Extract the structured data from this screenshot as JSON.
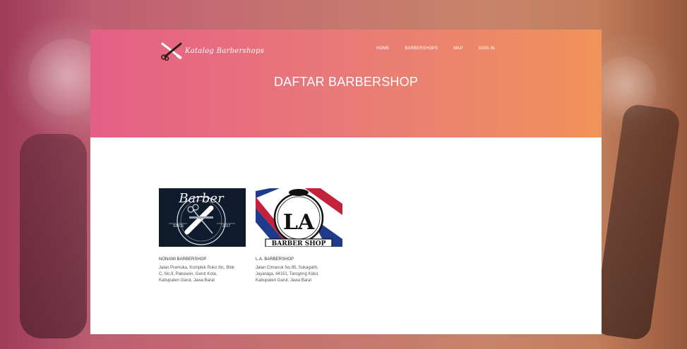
{
  "brand": {
    "name": "Katalog Barbershops",
    "icon": "crossed-razor-scissors-icon"
  },
  "nav": {
    "items": [
      {
        "label": "HOME"
      },
      {
        "label": "BARBERSHOPS"
      },
      {
        "label": "MAP"
      },
      {
        "label": "SIGN IN"
      }
    ]
  },
  "header": {
    "title": "DAFTAR BARBERSHOP"
  },
  "cards": [
    {
      "image_text": "Barber",
      "image_since": "SINCE",
      "image_year": "2017",
      "name": "NONAMI BARBERSHOP",
      "address": "Jalan Pramuka, Komplek Ruko Ibc, Blok C, No.9, Pakuwon, Garut Kota, Kabupaten Garut, Jawa Barat"
    },
    {
      "image_text": "LA",
      "image_banner": "BARBER SHOP",
      "name": "L.A. BARBERSHOP",
      "address": "Jalan Cimanuk No.95, Sukagalih, Jayaraga, 44151, Tarogong Kidul, Kabupaten Garut, Jawa Barat"
    }
  ],
  "colors": {
    "header_start": "#e55f86",
    "header_end": "#f0935a",
    "card1_bg": "#0f1a2b",
    "stripe_red": "#c4213a",
    "stripe_blue": "#1e3a8a"
  }
}
